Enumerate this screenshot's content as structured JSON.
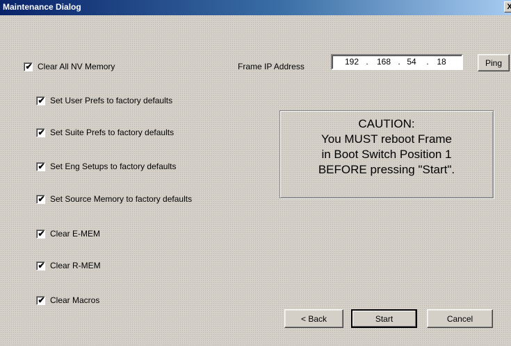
{
  "window": {
    "title": "Maintenance Dialog",
    "close_label": "X"
  },
  "options": {
    "clear_all": {
      "label": "Clear All NV Memory",
      "checked": true
    },
    "items": [
      {
        "label": "Set User Prefs to factory defaults",
        "checked": true
      },
      {
        "label": "Set Suite Prefs to factory defaults",
        "checked": true
      },
      {
        "label": "Set Eng Setups to factory defaults",
        "checked": true
      },
      {
        "label": "Set Source Memory to factory defaults",
        "checked": true
      },
      {
        "label": "Clear E-MEM",
        "checked": true
      },
      {
        "label": "Clear R-MEM",
        "checked": true
      },
      {
        "label": "Clear Macros",
        "checked": true
      }
    ],
    "check_glyph": "✔"
  },
  "ip": {
    "label": "Frame IP Address",
    "octets": [
      "192",
      "168",
      "54",
      "18"
    ],
    "separator": ".",
    "ping_label": "Ping"
  },
  "caution": {
    "lines": [
      "CAUTION:",
      "You MUST reboot Frame",
      "in Boot Switch Position 1",
      "BEFORE pressing \"Start\"."
    ]
  },
  "buttons": {
    "back": "< Back",
    "start": "Start",
    "cancel": "Cancel"
  }
}
